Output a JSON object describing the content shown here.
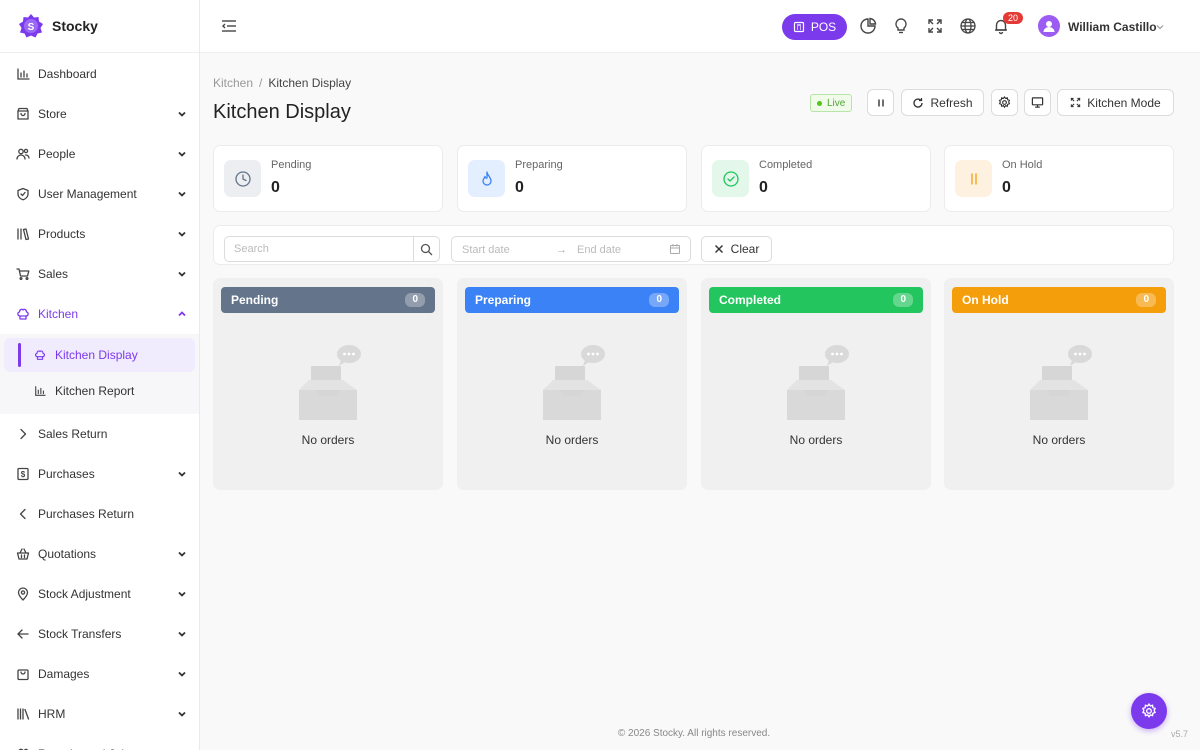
{
  "app": {
    "name": "Stocky"
  },
  "header": {
    "pos_label": "POS",
    "notification_count": "20",
    "user_name": "William Castillo"
  },
  "sidebar": {
    "items": [
      {
        "label": "Dashboard",
        "icon": "chart-icon",
        "chevron": "none"
      },
      {
        "label": "Store",
        "icon": "store-icon",
        "chevron": "down"
      },
      {
        "label": "People",
        "icon": "people-icon",
        "chevron": "down"
      },
      {
        "label": "User Management",
        "icon": "shield-icon",
        "chevron": "down"
      },
      {
        "label": "Products",
        "icon": "products-icon",
        "chevron": "down"
      },
      {
        "label": "Sales",
        "icon": "cart-icon",
        "chevron": "down"
      },
      {
        "label": "Kitchen",
        "icon": "chef-hat-icon",
        "chevron": "up"
      },
      {
        "label": "Sales Return",
        "icon": "chevron-right-icon",
        "chevron": "none"
      },
      {
        "label": "Purchases",
        "icon": "purchases-icon",
        "chevron": "down"
      },
      {
        "label": "Purchases Return",
        "icon": "chevron-left-icon",
        "chevron": "none"
      },
      {
        "label": "Quotations",
        "icon": "basket-icon",
        "chevron": "down"
      },
      {
        "label": "Stock Adjustment",
        "icon": "location-icon",
        "chevron": "down"
      },
      {
        "label": "Stock Transfers",
        "icon": "arrow-left-icon",
        "chevron": "down"
      },
      {
        "label": "Damages",
        "icon": "bag-icon",
        "chevron": "down"
      },
      {
        "label": "HRM",
        "icon": "library-icon",
        "chevron": "down"
      },
      {
        "label": "Recruits and Jobs",
        "icon": "people-icon",
        "chevron": "down"
      }
    ],
    "kitchen_sub": [
      {
        "label": "Kitchen Display",
        "icon": "chef-hat-icon",
        "active": true
      },
      {
        "label": "Kitchen Report",
        "icon": "chart-icon",
        "active": false
      }
    ]
  },
  "breadcrumb": {
    "parent": "Kitchen",
    "separator": "/",
    "current": "Kitchen Display"
  },
  "page_title": "Kitchen Display",
  "toolbar": {
    "live_label": "Live",
    "refresh_label": "Refresh",
    "kitchen_mode_label": "Kitchen Mode"
  },
  "stats": [
    {
      "label": "Pending",
      "value": "0",
      "icon": "clock-icon",
      "color": "#64748b",
      "bg": "#eceef2"
    },
    {
      "label": "Preparing",
      "value": "0",
      "icon": "flame-icon",
      "color": "#3b82f6",
      "bg": "#e3eefe"
    },
    {
      "label": "Completed",
      "value": "0",
      "icon": "check-circle-icon",
      "color": "#22c55e",
      "bg": "#e3f8ea"
    },
    {
      "label": "On Hold",
      "value": "0",
      "icon": "pause-icon",
      "color": "#f59e0b",
      "bg": "#fef1e0"
    }
  ],
  "filters": {
    "search_placeholder": "Search",
    "start_date_placeholder": "Start date",
    "end_date_placeholder": "End date",
    "clear_label": "Clear"
  },
  "columns": [
    {
      "title": "Pending",
      "count": "0",
      "color": "#64748b",
      "empty_text": "No orders"
    },
    {
      "title": "Preparing",
      "count": "0",
      "color": "#3b82f6",
      "empty_text": "No orders"
    },
    {
      "title": "Completed",
      "count": "0",
      "color": "#22c55e",
      "empty_text": "No orders"
    },
    {
      "title": "On Hold",
      "count": "0",
      "color": "#f59e0b",
      "empty_text": "No orders"
    }
  ],
  "footer": {
    "copyright": "© 2026 Stocky. All rights reserved.",
    "version": "v5.7"
  },
  "colors": {
    "brand": "#7c3aed"
  }
}
